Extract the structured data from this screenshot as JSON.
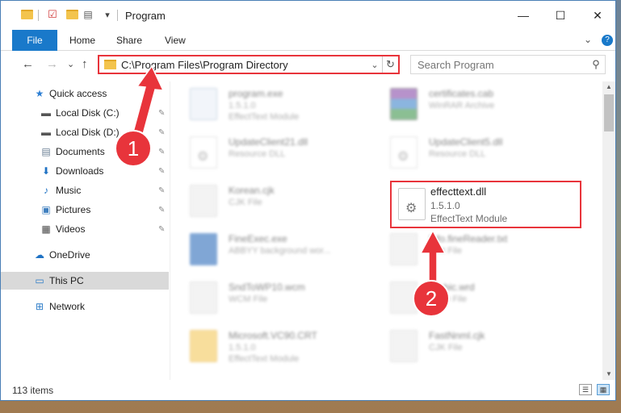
{
  "titlebar": {
    "title": "Program",
    "quick_access_dropdown": "▾",
    "minimize": "—",
    "maximize": "☐",
    "close": "✕"
  },
  "ribbon": {
    "tabs": [
      "File",
      "Home",
      "Share",
      "View"
    ],
    "expand_icon": "⌄",
    "help_icon": "?"
  },
  "nav": {
    "back": "←",
    "forward": "→",
    "recent": "⌄",
    "up": "↑",
    "address_path": "C:\\Program Files\\Program Directory",
    "address_dropdown": "⌄",
    "refresh": "↻",
    "search_placeholder": "Search Program",
    "search_icon": "⚲"
  },
  "sidebar": {
    "items": [
      {
        "label": "Quick access",
        "icon": "star-icon",
        "glyph": "★",
        "color": "#2d7fd3"
      },
      {
        "label": "Local Disk (C:)",
        "icon": "drive-icon",
        "glyph": "▬",
        "color": "#555555",
        "pinned": true
      },
      {
        "label": "Local Disk (D:)",
        "icon": "drive-icon",
        "glyph": "▬",
        "color": "#555555",
        "pinned": true
      },
      {
        "label": "Documents",
        "icon": "document-icon",
        "glyph": "▤",
        "color": "#6a7f95",
        "pinned": true
      },
      {
        "label": "Downloads",
        "icon": "download-icon",
        "glyph": "⬇",
        "color": "#1f72c4",
        "pinned": true
      },
      {
        "label": "Music",
        "icon": "music-icon",
        "glyph": "♪",
        "color": "#1f72c4",
        "pinned": true
      },
      {
        "label": "Pictures",
        "icon": "pictures-icon",
        "glyph": "▣",
        "color": "#3f7fbf",
        "pinned": true
      },
      {
        "label": "Videos",
        "icon": "video-icon",
        "glyph": "▦",
        "color": "#444444",
        "pinned": true
      },
      {
        "label": "OneDrive",
        "icon": "cloud-icon",
        "glyph": "☁",
        "color": "#1f72c4"
      },
      {
        "label": "This PC",
        "icon": "computer-icon",
        "glyph": "▭",
        "color": "#2a7bc8"
      },
      {
        "label": "Network",
        "icon": "network-icon",
        "glyph": "⊞",
        "color": "#2a7bc8"
      }
    ],
    "pin_glyph": "📌"
  },
  "files": [
    {
      "name": "program.exe",
      "line1": "1.5.1.0",
      "line2": "EffectText Module",
      "kind": "exe"
    },
    {
      "name": "certificates.cab",
      "line1": "WinRAR Archive",
      "line2": "",
      "kind": "rar"
    },
    {
      "name": "UpdateClient21.dll",
      "line1": "Resource DLL",
      "line2": "",
      "kind": "dll"
    },
    {
      "name": "UpdateClient5.dll",
      "line1": "Resource DLL",
      "line2": "",
      "kind": "dll"
    },
    {
      "name": "Korean.cjk",
      "line1": "CJK File",
      "line2": "",
      "kind": "txt"
    },
    {
      "name": "FineExec.exe",
      "line1": "ABBYY background wor...",
      "line2": "",
      "kind": "exe2"
    },
    {
      "name": "Info.fineReader.txt",
      "line1": "Text File",
      "line2": "",
      "kind": "txt"
    },
    {
      "name": "SndToWP10.wcm",
      "line1": "WCM File",
      "line2": "",
      "kind": "txt"
    },
    {
      "name": "Arabic.wrd",
      "line1": "WRD File",
      "line2": "",
      "kind": "txt"
    },
    {
      "name": "Microsoft.VC90.CRT",
      "line1": "1.5.1.0",
      "line2": "EffectText Module",
      "kind": "folder"
    },
    {
      "name": "FastNnml.cjk",
      "line1": "CJK File",
      "line2": "",
      "kind": "txt"
    }
  ],
  "selected_file": {
    "name": "effecttext.dll",
    "version": "1.5.1.0",
    "description": "EffectText Module"
  },
  "status": {
    "item_count": "113 items"
  },
  "annotations": {
    "step1": "1",
    "step2": "2",
    "color": "#e8343b"
  }
}
